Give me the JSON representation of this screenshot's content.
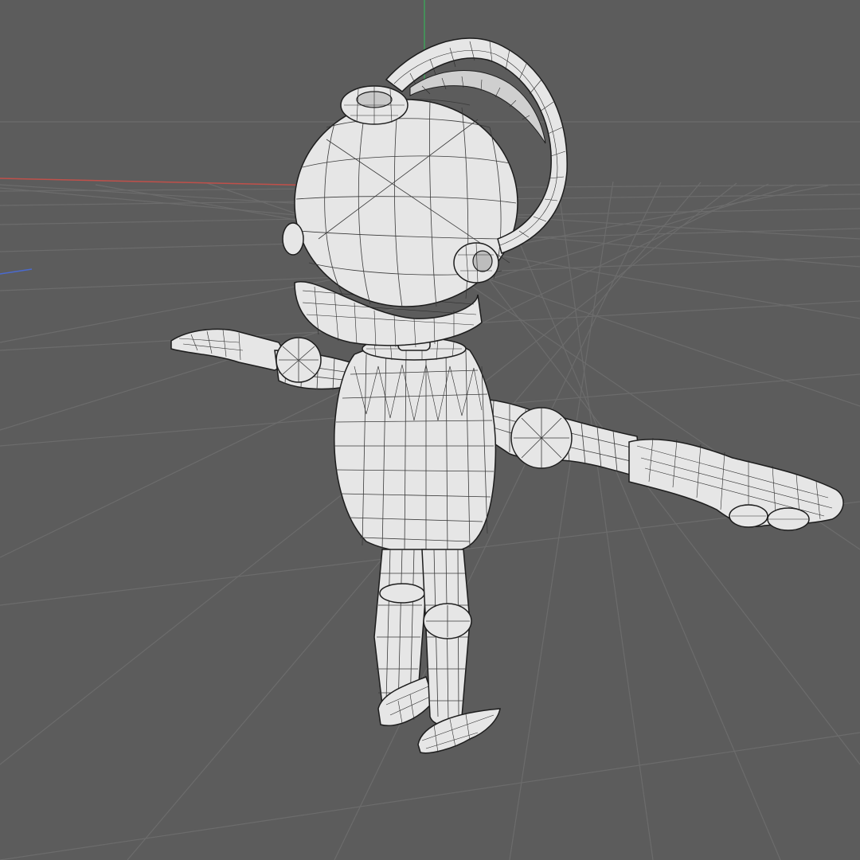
{
  "viewport": {
    "background_color": "#5c5c5c",
    "grid_color": "#6c6c6c",
    "mesh_fill_color": "#e6e6e6",
    "wire_color": "#1d1d1d"
  },
  "axes": {
    "x_axis_color": "#c0504a",
    "y_axis_color": "#3fa05a",
    "z_axis_color": "#4a6acf"
  },
  "model": {
    "display_mode": "shaded-wireframe",
    "pose": "T-pose"
  }
}
